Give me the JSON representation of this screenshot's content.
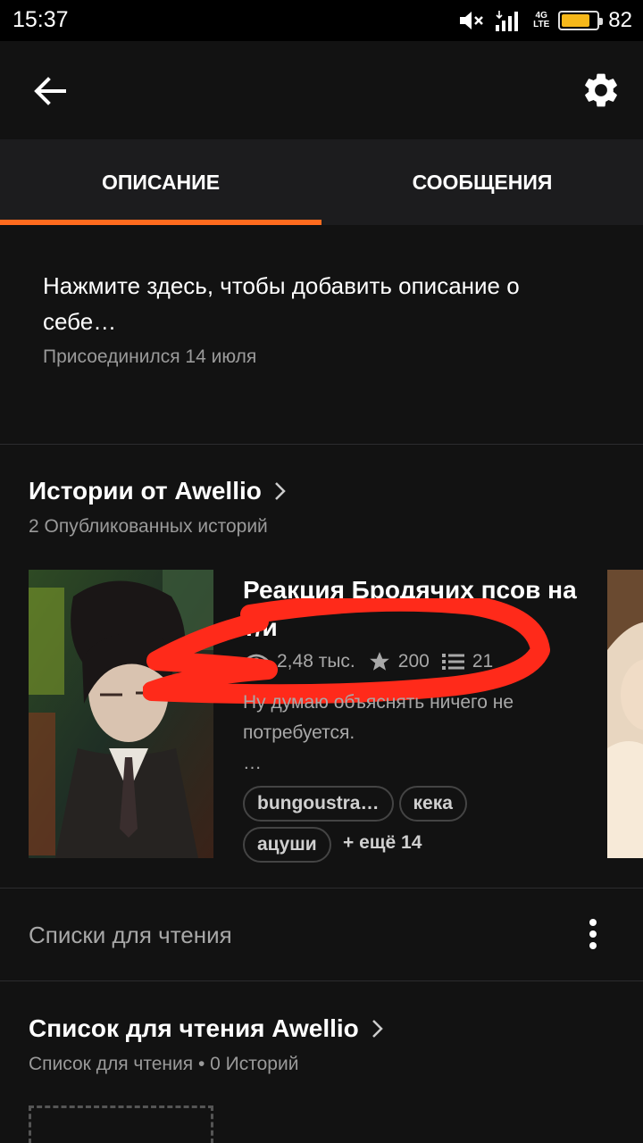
{
  "status_bar": {
    "time": "15:37",
    "network": "4G LTE",
    "battery_percent": "82",
    "battery_level": 0.82
  },
  "tabs": [
    {
      "label": "ОПИСАНИЕ",
      "active": true
    },
    {
      "label": "СООБЩЕНИЯ",
      "active": false
    }
  ],
  "about": {
    "prompt": "Нажмите здесь, чтобы добавить описание о себе…",
    "joined": "Присоединился 14 июля"
  },
  "stories": {
    "heading": "Истории от Awellio",
    "subheading": "2 Опубликованных историй",
    "items": [
      {
        "title": "Реакция Бродячих псов на т/и",
        "views": "2,48 тыс.",
        "votes": "200",
        "parts": "21",
        "description": "Ну думаю объяснять ничего не потребуется.",
        "ellipsis": "…",
        "tags": [
          "bungoustra…",
          "кека",
          "ацуши"
        ],
        "more_tags": "+ ещё 14"
      }
    ]
  },
  "reading_lists": {
    "section_label": "Списки для чтения",
    "list_title": "Список для чтения Awellio",
    "list_meta": "Список для чтения • 0 Историй"
  },
  "colors": {
    "accent": "#ff6b1e",
    "background": "#121212",
    "annotation": "#ff2a1a"
  }
}
